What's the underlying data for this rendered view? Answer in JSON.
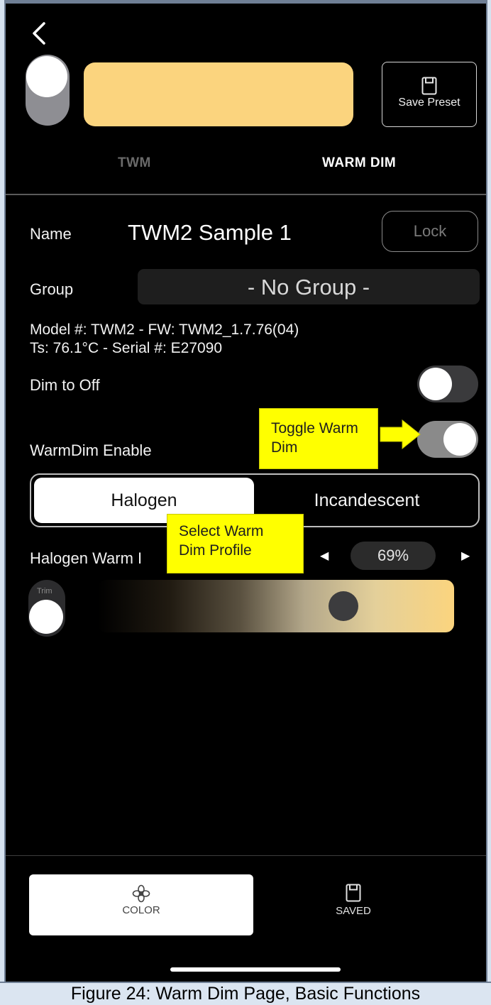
{
  "header": {
    "save_preset_label": "Save Preset",
    "swatch_color": "#fbd47e"
  },
  "tabs": [
    {
      "label": "TWM",
      "active": false
    },
    {
      "label": "WARM DIM",
      "active": true
    }
  ],
  "details": {
    "name_label": "Name",
    "name_value": "TWM2 Sample 1",
    "lock_label": "Lock",
    "group_label": "Group",
    "group_value": "- No Group -",
    "model_line": "Model #: TWM2 - FW: TWM2_1.7.76(04)",
    "ts_line": "Ts: 76.1°C - Serial #: E27090",
    "dim_to_off_label": "Dim to Off",
    "dim_to_off_on": false,
    "warmdim_enable_label": "WarmDim Enable",
    "warmdim_enable_on": true
  },
  "profile": {
    "options": [
      "Halogen",
      "Incandescent"
    ],
    "selected": "Halogen"
  },
  "warm_dim": {
    "label": "Halogen Warm I",
    "value_text": "69%",
    "level": 0.69,
    "trim_label": "Trim"
  },
  "callouts": {
    "toggle": "Toggle Warm Dim",
    "profile": "Select Warm Dim Profile"
  },
  "bottom_nav": [
    {
      "label": "COLOR",
      "icon": "flower-icon",
      "active": true
    },
    {
      "label": "SAVED",
      "icon": "save-icon",
      "active": false
    }
  ],
  "caption": "Figure 24: Warm Dim Page, Basic Functions",
  "colors": {
    "accent_warm": "#fbd47e",
    "callout_yellow": "#ffff00"
  }
}
